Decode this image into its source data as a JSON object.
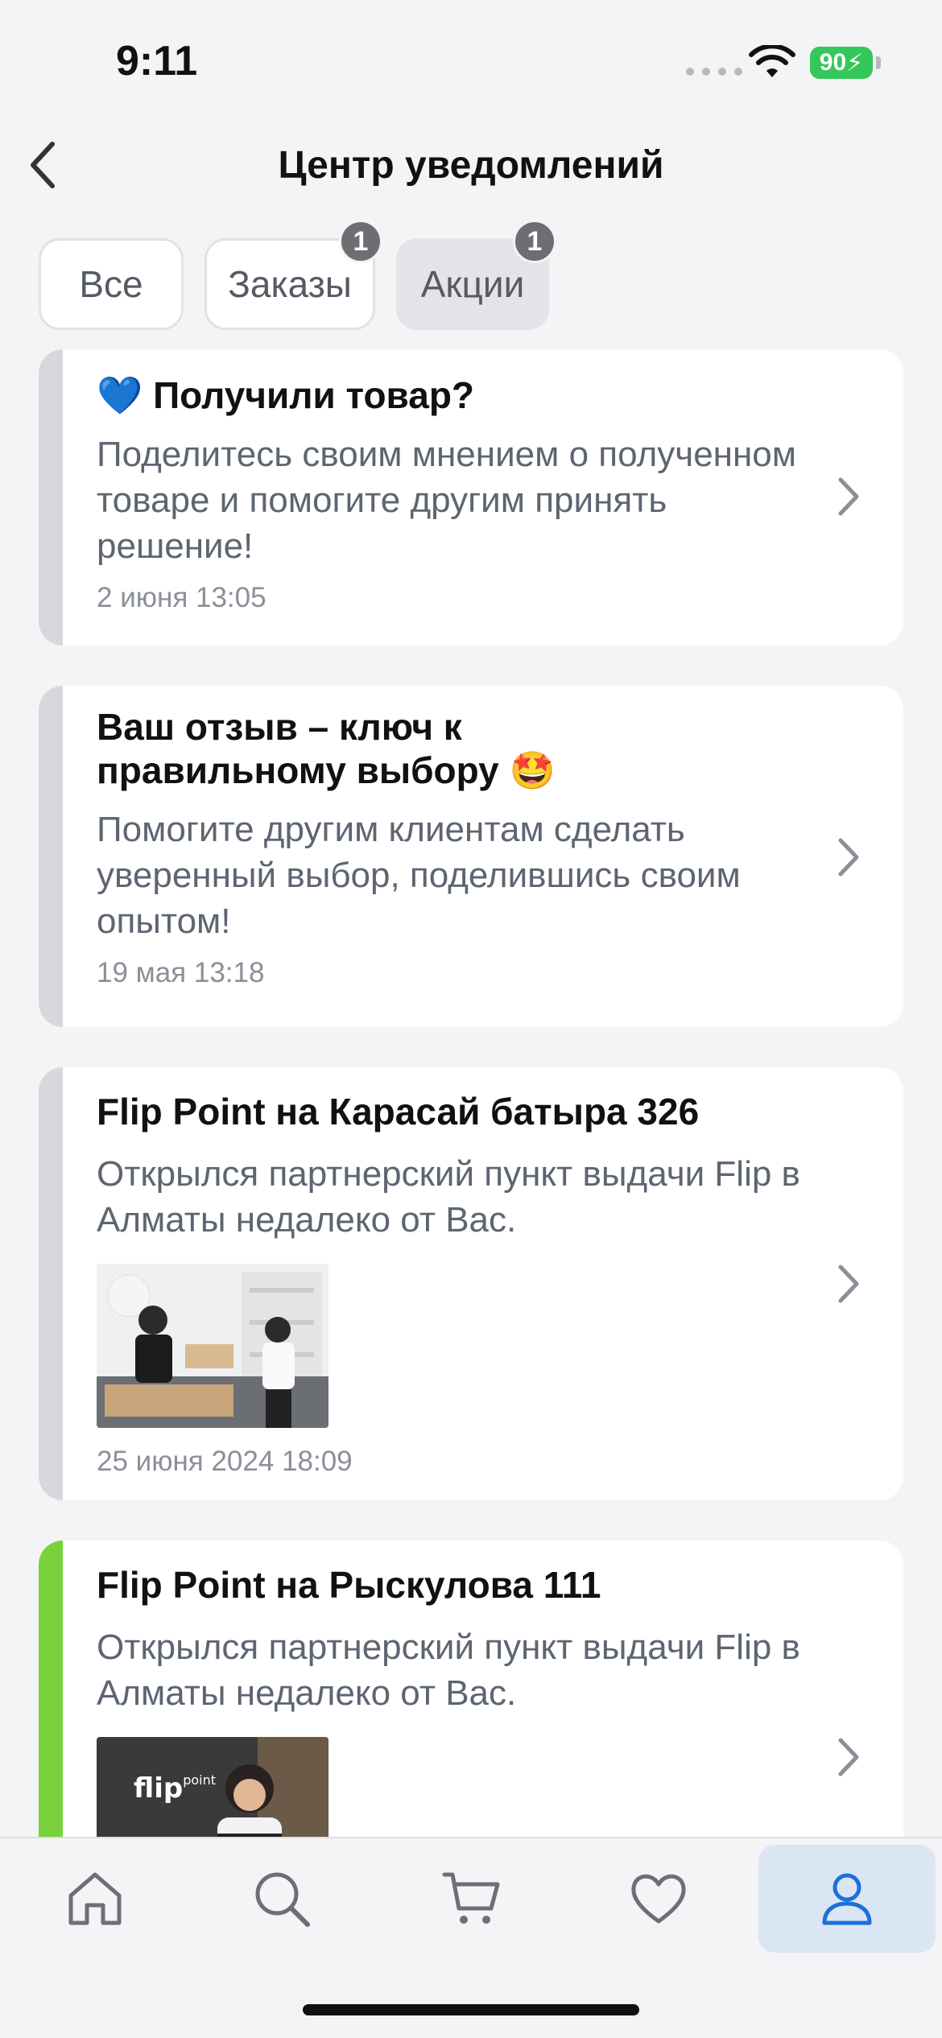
{
  "status_bar": {
    "time": "9:11",
    "battery": "90"
  },
  "header": {
    "title": "Центр уведомлений"
  },
  "tabs": [
    {
      "label": "Все",
      "badge": null
    },
    {
      "label": "Заказы",
      "badge": "1"
    },
    {
      "label": "Акции",
      "badge": "1"
    }
  ],
  "notifications": [
    {
      "emoji": "💙",
      "title": "Получили товар?",
      "text": "Поделитесь своим мнением о полученном товаре и помогите другим принять решение!",
      "date": "2 июня 13:05"
    },
    {
      "title": "Ваш отзыв – ключ к правильному выбору",
      "emoji": "🤩",
      "text": "Помогите другим клиентам сделать уверенный выбор, поделившись своим опытом!",
      "date": "19 мая 13:18"
    },
    {
      "title": "Flip Point на Карасай батыра 326",
      "text": "Открылся партнерский пункт выдачи Flip в Алматы недалеко от Вас.",
      "date": "25 июня 2024 18:09"
    },
    {
      "title": "Flip Point на Рыскулова 111",
      "text": "Открылся партнерский пункт выдачи Flip в Алматы недалеко от Вас.",
      "image_logo": "flip",
      "image_logo_small": "point"
    }
  ],
  "nav": [
    "home-icon",
    "search-icon",
    "cart-icon",
    "heart-icon",
    "profile-icon"
  ],
  "colors": {
    "accent": "#1e6fd9",
    "unread_bar": "#77d23b",
    "read_bar": "#d8d8dc",
    "active_nav_bg": "#dbe6f4"
  }
}
